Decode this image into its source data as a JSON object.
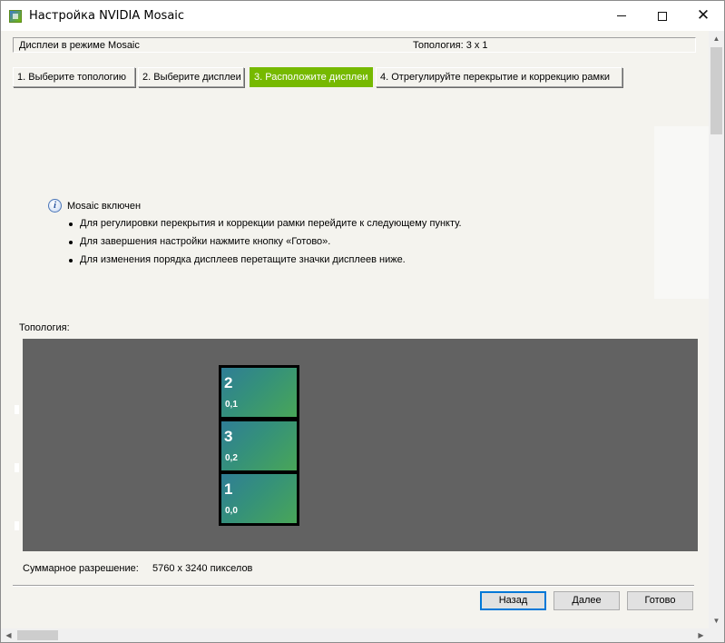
{
  "window": {
    "title": "Настройка NVIDIA Mosaic",
    "close_glyph": "✕"
  },
  "status": {
    "mode_label": "Дисплеи в режиме Mosaic",
    "topology_text": "Топология: 3 x 1"
  },
  "steps": [
    {
      "label": "1. Выберите топологию"
    },
    {
      "label": "2. Выберите дисплеи"
    },
    {
      "label": "3. Расположите дисплеи"
    },
    {
      "label": "4. Отрегулируйте перекрытие и коррекцию рамки"
    }
  ],
  "info": {
    "icon_glyph": "i",
    "title": "Mosaic включен",
    "bullets": [
      "Для регулировки перекрытия и коррекции рамки перейдите к следующему пункту.",
      "Для завершения настройки нажмите кнопку «Готово».",
      "Для изменения порядка дисплеев перетащите значки дисплеев ниже."
    ]
  },
  "topology": {
    "label": "Топология:",
    "displays": [
      {
        "number": "2",
        "coords": "0,1"
      },
      {
        "number": "3",
        "coords": "0,2"
      },
      {
        "number": "1",
        "coords": "0,0"
      }
    ]
  },
  "resolution": {
    "label": "Суммарное разрешение:",
    "value": "5760 x 3240 пикселов"
  },
  "buttons": {
    "back": "Назад",
    "next": "Далее",
    "done": "Готово"
  },
  "scroll": {
    "up": "▲",
    "down": "▼",
    "left": "◀",
    "right": "▶"
  },
  "colors": {
    "accent": "#76b900",
    "topology_bg": "#626262",
    "default_button_border": "#0078d7"
  }
}
